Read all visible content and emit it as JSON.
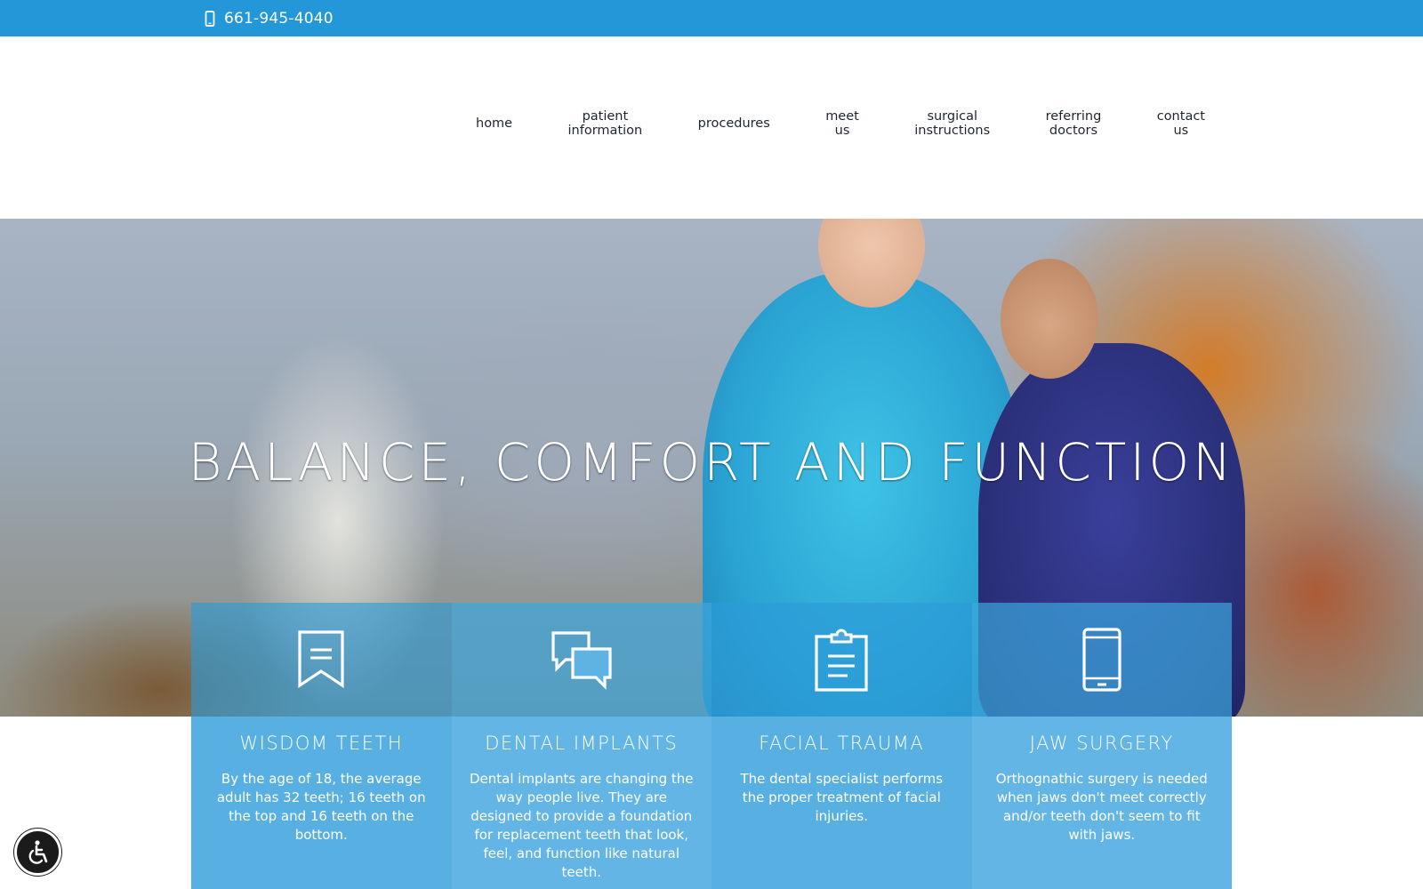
{
  "topbar": {
    "phone": "661-945-4040",
    "background": "#2497d8"
  },
  "nav": {
    "items": [
      {
        "line1": "home",
        "line2": ""
      },
      {
        "line1": "patient",
        "line2": "information"
      },
      {
        "line1": "procedures",
        "line2": ""
      },
      {
        "line1": "meet",
        "line2": "us"
      },
      {
        "line1": "surgical",
        "line2": "instructions"
      },
      {
        "line1": "referring",
        "line2": "doctors"
      },
      {
        "line1": "contact",
        "line2": "us"
      }
    ]
  },
  "hero": {
    "title": "BALANCE, COMFORT AND FUNCTION"
  },
  "cards": [
    {
      "icon": "bookmark-icon",
      "title": "WISDOM TEETH",
      "text": "By the age of 18, the average adult has 32 teeth; 16 teeth on the top and 16 teeth on the bottom."
    },
    {
      "icon": "chat-bubbles-icon",
      "title": "DENTAL IMPLANTS",
      "text": "Dental implants are changing the way people live. They are designed to provide a foundation for replacement teeth that look, feel, and function like natural teeth."
    },
    {
      "icon": "clipboard-icon",
      "title": "FACIAL TRAUMA",
      "text": "The dental specialist performs the proper treatment of facial injuries."
    },
    {
      "icon": "mobile-device-icon",
      "title": "JAW SURGERY",
      "text": "Orthognathic surgery is needed when jaws don't meet correctly and/or teeth don't seem to fit with jaws."
    }
  ],
  "accessibility": {
    "icon": "wheelchair-icon"
  }
}
